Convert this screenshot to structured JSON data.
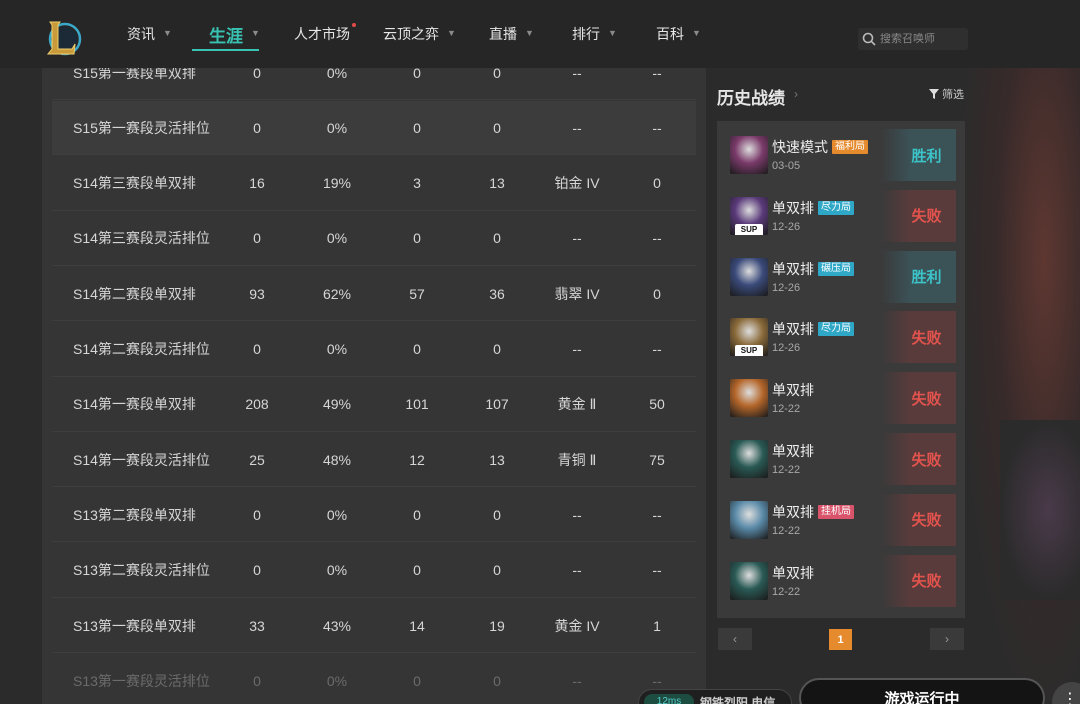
{
  "nav": {
    "items": [
      {
        "label": "资讯",
        "chevron": true
      },
      {
        "label": "生涯",
        "chevron": true,
        "active": true
      },
      {
        "label": "人才市场",
        "chevron": false,
        "dot": true
      },
      {
        "label": "云顶之弈",
        "chevron": true
      },
      {
        "label": "直播",
        "chevron": true
      },
      {
        "label": "排行",
        "chevron": true
      },
      {
        "label": "百科",
        "chevron": true
      }
    ],
    "search_placeholder": "搜索召唤师",
    "accent": "#39c3b2"
  },
  "ranked_table": {
    "rows": [
      {
        "season": "S15第一赛段单双排",
        "c1": "0",
        "c2": "0%",
        "c3": "0",
        "c4": "0",
        "tier": "--",
        "lp": "--"
      },
      {
        "season": "S15第一赛段灵活排位",
        "c1": "0",
        "c2": "0%",
        "c3": "0",
        "c4": "0",
        "tier": "--",
        "lp": "--"
      },
      {
        "season": "S14第三赛段单双排",
        "c1": "16",
        "c2": "19%",
        "c3": "3",
        "c4": "13",
        "tier": "铂金 IV",
        "lp": "0"
      },
      {
        "season": "S14第三赛段灵活排位",
        "c1": "0",
        "c2": "0%",
        "c3": "0",
        "c4": "0",
        "tier": "--",
        "lp": "--"
      },
      {
        "season": "S14第二赛段单双排",
        "c1": "93",
        "c2": "62%",
        "c3": "57",
        "c4": "36",
        "tier": "翡翠 IV",
        "lp": "0"
      },
      {
        "season": "S14第二赛段灵活排位",
        "c1": "0",
        "c2": "0%",
        "c3": "0",
        "c4": "0",
        "tier": "--",
        "lp": "--"
      },
      {
        "season": "S14第一赛段单双排",
        "c1": "208",
        "c2": "49%",
        "c3": "101",
        "c4": "107",
        "tier": "黄金 Ⅱ",
        "lp": "50"
      },
      {
        "season": "S14第一赛段灵活排位",
        "c1": "25",
        "c2": "48%",
        "c3": "12",
        "c4": "13",
        "tier": "青铜 Ⅱ",
        "lp": "75"
      },
      {
        "season": "S13第二赛段单双排",
        "c1": "0",
        "c2": "0%",
        "c3": "0",
        "c4": "0",
        "tier": "--",
        "lp": "--"
      },
      {
        "season": "S13第二赛段灵活排位",
        "c1": "0",
        "c2": "0%",
        "c3": "0",
        "c4": "0",
        "tier": "--",
        "lp": "--"
      },
      {
        "season": "S13第一赛段单双排",
        "c1": "33",
        "c2": "43%",
        "c3": "14",
        "c4": "19",
        "tier": "黄金 IV",
        "lp": "1"
      },
      {
        "season": "S13第一赛段灵活排位",
        "c1": "0",
        "c2": "0%",
        "c3": "0",
        "c4": "0",
        "tier": "--",
        "lp": "--"
      }
    ]
  },
  "history": {
    "title": "历史战绩",
    "filter_label": "筛选",
    "matches": [
      {
        "mode": "快速模式",
        "tag": "福利局",
        "tag_type": "fuli",
        "date": "03-05",
        "result": "胜利",
        "win": true,
        "avatar": "#7a3a6a",
        "sup": false
      },
      {
        "mode": "单双排",
        "tag": "尽力局",
        "tag_type": "jinli",
        "date": "12-26",
        "result": "失败",
        "win": false,
        "avatar": "#5a3a7a",
        "sup": true,
        "sup_text": "SUP"
      },
      {
        "mode": "单双排",
        "tag": "碾压局",
        "tag_type": "jinli",
        "date": "12-26",
        "result": "胜利",
        "win": true,
        "avatar": "#3a4a7a",
        "sup": false
      },
      {
        "mode": "单双排",
        "tag": "尽力局",
        "tag_type": "jinli",
        "date": "12-26",
        "result": "失败",
        "win": false,
        "avatar": "#8a6a3a",
        "sup": true,
        "sup_text": "SUP"
      },
      {
        "mode": "单双排",
        "tag": "",
        "tag_type": "",
        "date": "12-22",
        "result": "失败",
        "win": false,
        "avatar": "#b4662a",
        "sup": false
      },
      {
        "mode": "单双排",
        "tag": "",
        "tag_type": "",
        "date": "12-22",
        "result": "失败",
        "win": false,
        "avatar": "#2a5a55",
        "sup": false
      },
      {
        "mode": "单双排",
        "tag": "挂机局",
        "tag_type": "guaji",
        "date": "12-22",
        "result": "失败",
        "win": false,
        "avatar": "#5a8aa8",
        "sup": false
      },
      {
        "mode": "单双排",
        "tag": "",
        "tag_type": "",
        "date": "12-22",
        "result": "失败",
        "win": false,
        "avatar": "#2a5a55",
        "sup": false
      }
    ],
    "page": "1"
  },
  "status": {
    "ping": "12ms",
    "server": "钢铁烈阳 电信",
    "play_label": "游戏运行中",
    "more": "⋮"
  }
}
